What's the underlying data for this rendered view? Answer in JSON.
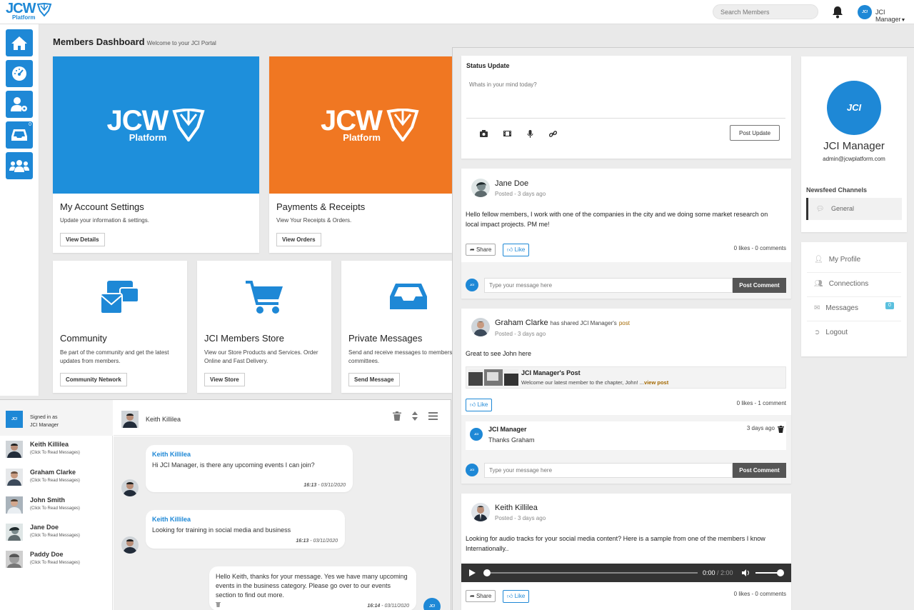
{
  "header": {
    "logo_main": "JCW",
    "logo_sub": "Platform",
    "search_placeholder": "Search Members",
    "user_label": "JCI Manager",
    "avatar_text": "JCI"
  },
  "sidebar": {
    "items": [
      {
        "name": "home"
      },
      {
        "name": "dashboard"
      },
      {
        "name": "user-settings"
      },
      {
        "name": "inbox",
        "badge": "0"
      },
      {
        "name": "community"
      }
    ]
  },
  "dashboard": {
    "title": "Members Dashboard",
    "subtitle": "Welcome to your JCI Portal",
    "banner_word": "JCW",
    "banner_sub": "Platform",
    "cards": [
      {
        "title": "My Account Settings",
        "desc": "Update your information & settings.",
        "button": "View Details",
        "color": "#1e8fdb"
      },
      {
        "title": "Payments & Receipts",
        "desc": "View Your Receipts & Orders.",
        "button": "View Orders",
        "color": "#f07722"
      },
      {
        "title": "Community",
        "desc": "Be part of the community and get the latest updates from members.",
        "button": "Community Network"
      },
      {
        "title": "JCI Members Store",
        "desc": "View our Store Products and Services. Order Online and Fast Delivery.",
        "button": "View Store"
      },
      {
        "title": "Private Messages",
        "desc": "Send and receive messages to members project committees.",
        "button": "Send Message"
      }
    ]
  },
  "status": {
    "title": "Status Update",
    "placeholder": "Whats in your mind today?",
    "button": "Post Update"
  },
  "posts": [
    {
      "author": "Jane Doe",
      "meta": "Posted - 3 days ago",
      "text": "Hello fellow members, I work with one of the companies in the city and we doing some market research on local impact projects. PM me!",
      "share": "Share",
      "like": "Like",
      "stats": "0 likes - 0 comments",
      "comment_placeholder": "Type your message here",
      "comment_button": "Post Comment"
    },
    {
      "author": "Graham Clarke",
      "shared_text": "has shared JCI Manager's",
      "shared_link": "post",
      "meta": "Posted - 3 days ago",
      "text": "Great to see John here",
      "embed_title": "JCI Manager's Post",
      "embed_text": "Welcome our latest member to the chapter, John! ...",
      "embed_link": "view post",
      "like": "Like",
      "stats": "0 likes - 1 comment",
      "comment_author": "JCI Manager",
      "comment_text": "Thanks Graham",
      "comment_time": "3 days ago",
      "comment_placeholder": "Type your message here",
      "comment_button": "Post Comment"
    },
    {
      "author": "Keith Killilea",
      "meta": "Posted - 3 days ago",
      "text": "Looking for audio tracks for your social media content? Here is a sample from one of the members I know Internationally..",
      "audio_time": "0:00",
      "audio_total": "/ 2:00",
      "audio_progress": 0,
      "share": "Share",
      "like": "Like",
      "stats": "0 likes - 0 comments"
    }
  ],
  "profile": {
    "avatar_text": "JCI",
    "name": "JCI Manager",
    "email": "admin@jcwplatform.com",
    "channels_title": "Newsfeed Channels",
    "channel": "General"
  },
  "right_menu": [
    {
      "label": "My Profile"
    },
    {
      "label": "Connections"
    },
    {
      "label": "Messages",
      "badge": "0"
    },
    {
      "label": "Logout"
    }
  ],
  "chat": {
    "signed_in_label": "Signed in as",
    "signed_in_user": "JCI Manager",
    "active_contact": "Keith Killilea",
    "contacts": [
      {
        "name": "Keith Killilea",
        "hint": "(Click To Read Messages)"
      },
      {
        "name": "Graham Clarke",
        "hint": "(Click To Read Messages)"
      },
      {
        "name": "John Smith",
        "hint": "(Click To Read Messages)"
      },
      {
        "name": "Jane Doe",
        "hint": "(Click To Read Messages)"
      },
      {
        "name": "Paddy Doe",
        "hint": "(Click To Read Messages)"
      }
    ],
    "messages": [
      {
        "author": "Keith Killilea",
        "text": "Hi JCI Manager, is there any upcoming events I can join?",
        "time": "16:13",
        "date": " - 03/11/2020"
      },
      {
        "author": "Keith Killilea",
        "text": "Looking for training in social media and business",
        "time": "16:13",
        "date": " - 03/11/2020"
      },
      {
        "text": "Hello Keith, thanks for your message. Yes we have many upcoming events in the business category. Please go over to our events section to find out more.",
        "time": "16:14",
        "date": " - 03/11/2020"
      }
    ]
  }
}
